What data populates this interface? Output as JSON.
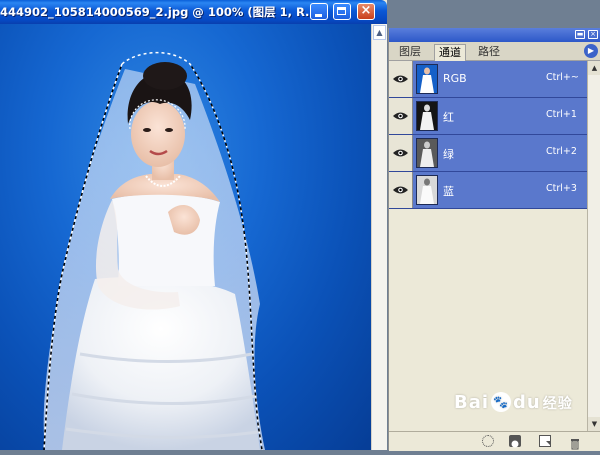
{
  "document": {
    "title": "444902_105814000569_2.jpg @ 100% (图层 1, R..."
  },
  "channels_panel": {
    "tabs": [
      {
        "label": "图层",
        "active": false
      },
      {
        "label": "通道",
        "active": true
      },
      {
        "label": "路径",
        "active": false
      }
    ],
    "channels": [
      {
        "name": "RGB",
        "shortcut": "Ctrl+~",
        "visible": true
      },
      {
        "name": "红",
        "shortcut": "Ctrl+1",
        "visible": true
      },
      {
        "name": "绿",
        "shortcut": "Ctrl+2",
        "visible": true
      },
      {
        "name": "蓝",
        "shortcut": "Ctrl+3",
        "visible": true
      }
    ],
    "footer_icons": [
      "dotted-circle-icon",
      "save-selection-icon",
      "new-channel-icon",
      "trash-icon"
    ]
  },
  "watermark": {
    "brand": "Bai",
    "brand2": "du",
    "suffix": "经验"
  },
  "colors": {
    "title_bar": "#0a58d6",
    "canvas_background": "#1668d2",
    "channel_row_selected": "#5a78cc",
    "panel_bg": "#ece9d8"
  }
}
